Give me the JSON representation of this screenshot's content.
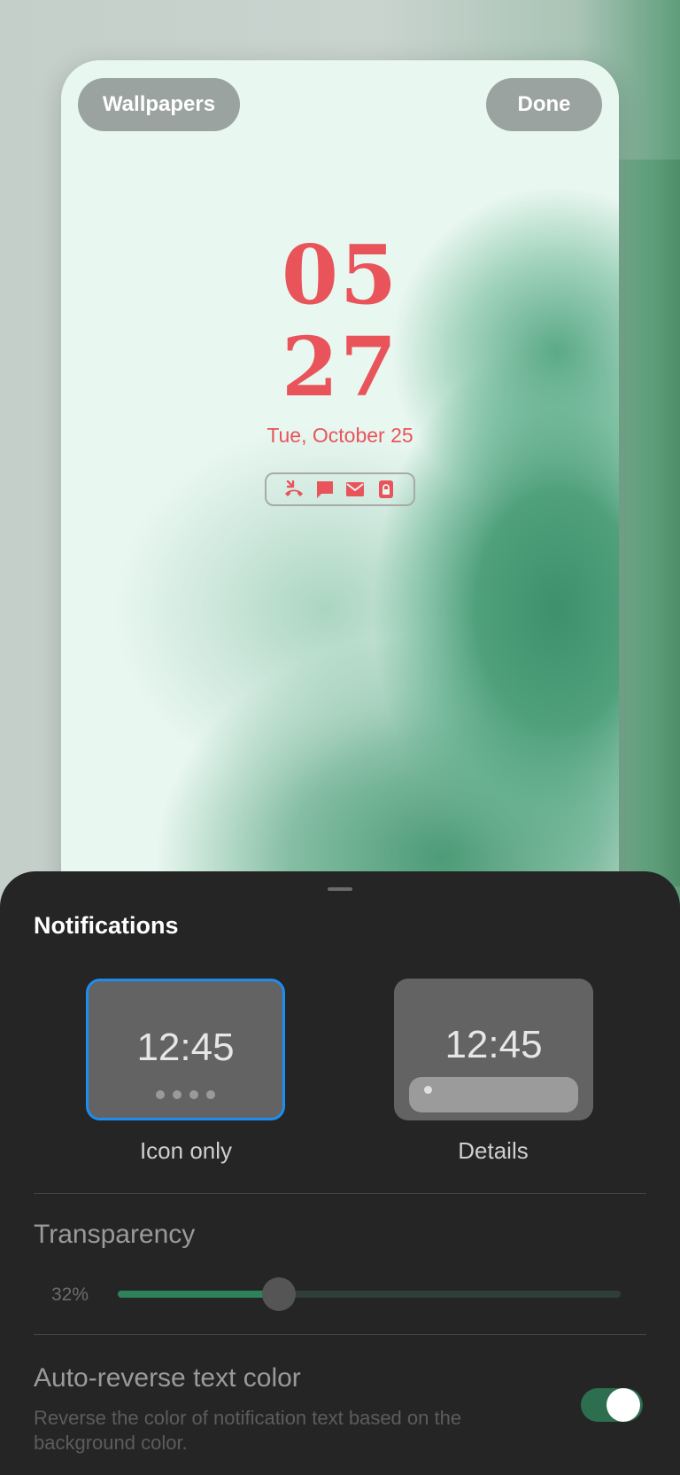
{
  "preview": {
    "wallpapers_label": "Wallpapers",
    "done_label": "Done",
    "clock_hour": "05",
    "clock_minute": "27",
    "date": "Tue, October 25",
    "notification_icons": [
      "missed-call-icon",
      "message-icon",
      "email-icon",
      "lock-icon"
    ],
    "accent_color": "#e9545b"
  },
  "sheet": {
    "title": "Notifications",
    "options": [
      {
        "time": "12:45",
        "label": "Icon only",
        "selected": true
      },
      {
        "time": "12:45",
        "label": "Details",
        "selected": false
      }
    ],
    "transparency": {
      "label": "Transparency",
      "value_text": "32%",
      "value": 32
    },
    "auto_reverse": {
      "label": "Auto-reverse text color",
      "description": "Reverse the color of notification text based on the background color.",
      "enabled": true
    }
  }
}
